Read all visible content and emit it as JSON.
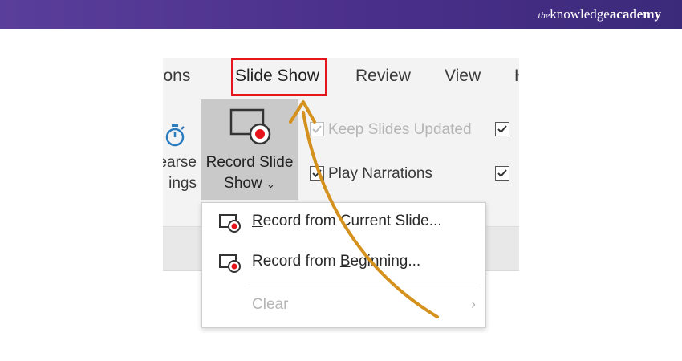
{
  "brand": {
    "prefix": "the",
    "name": "knowledge",
    "suffix": "academy"
  },
  "tabs": [
    {
      "label": "tions"
    },
    {
      "label": "Slide Show"
    },
    {
      "label": "Review"
    },
    {
      "label": "View"
    },
    {
      "label": "H"
    }
  ],
  "ribbon": {
    "record_button": {
      "line1": "Record Slide",
      "line2": "Show",
      "chevron": "⌄"
    },
    "rehearse": {
      "line1": "earse",
      "line2": "ings"
    },
    "options": [
      {
        "label": "Keep Slides Updated",
        "checked": true,
        "enabled": false
      },
      {
        "label": "Play Narrations",
        "checked": true,
        "enabled": true
      }
    ]
  },
  "menu": {
    "items": [
      {
        "pre": "",
        "ul": "R",
        "post": "ecord from Current Slide...",
        "icon": "record-slide-icon",
        "enabled": true
      },
      {
        "pre": "Record from ",
        "ul": "B",
        "post": "eginning...",
        "icon": "record-slide-icon",
        "enabled": true
      },
      {
        "pre": "",
        "ul": "C",
        "post": "lear",
        "icon": "",
        "enabled": false,
        "submenu_arrow": "›"
      }
    ]
  },
  "colors": {
    "accent_red": "#e6141b",
    "arrow_orange": "#d4911d",
    "header_purple": "#4a2f8a"
  }
}
